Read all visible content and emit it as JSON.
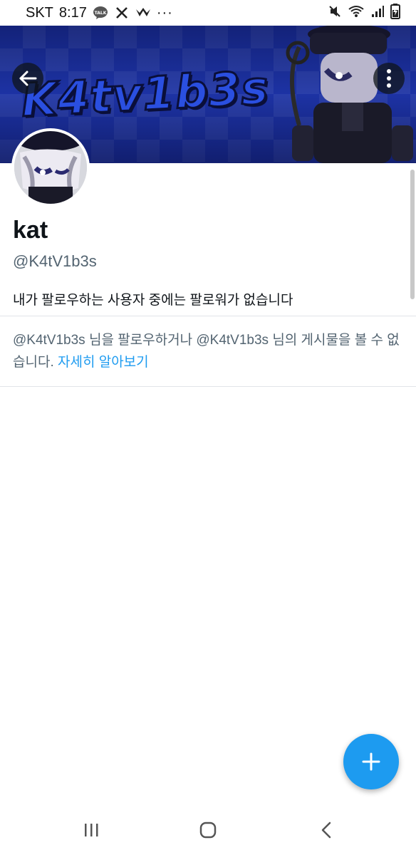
{
  "status_bar": {
    "carrier": "SKT",
    "time": "8:17",
    "talk_badge": "TALK",
    "more_dots": "···"
  },
  "banner": {
    "wordmark": "K4tv1b3s",
    "colors": {
      "base": "#1b2f9a",
      "wordmark": "#2a4fe0",
      "outline": "#0a0f3a"
    }
  },
  "profile": {
    "display_name": "kat",
    "handle": "@K4tV1b3s",
    "follow_note": "내가 팔로우하는 사용자 중에는 팔로워가 없습니다"
  },
  "protected_notice": {
    "text": "@K4tV1b3s 님을 팔로우하거나 @K4tV1b3s 님의 게시물을 볼 수 없습니다. ",
    "link_text": "자세히 알아보기"
  },
  "fab": {
    "icon": "plus-icon",
    "color": "#1d9bf0"
  },
  "nav_bar": {
    "icons": [
      "recent-apps-icon",
      "home-icon",
      "back-icon"
    ]
  }
}
